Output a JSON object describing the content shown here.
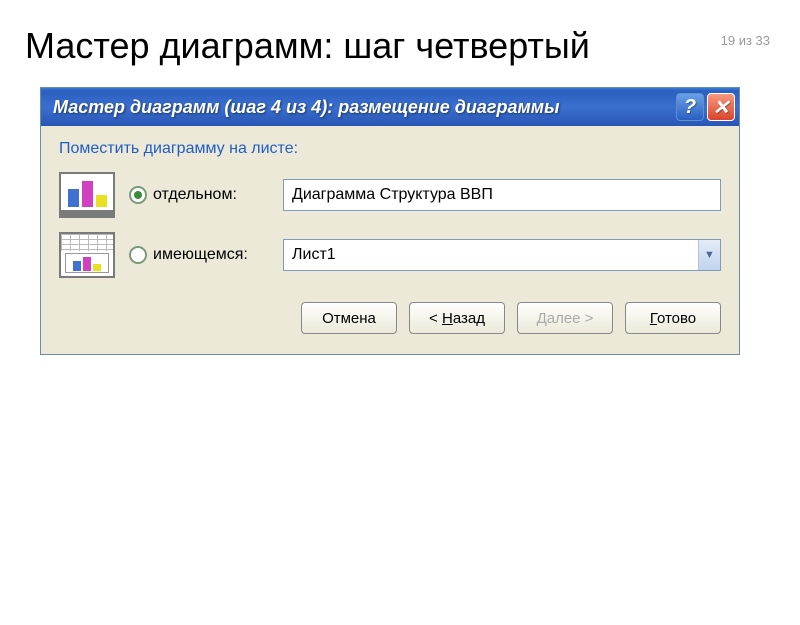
{
  "page_counter": "19 из 33",
  "page_title": "Мастер диаграмм: шаг четвертый",
  "dialog": {
    "title": "Мастер диаграмм (шаг 4 из 4): размещение диаграммы",
    "section_label": "Поместить диаграмму на листе:",
    "option_separate": {
      "label": "отдельном:",
      "value": "Диаграмма Структура ВВП",
      "checked": true
    },
    "option_existing": {
      "label": "имеющемся:",
      "value": "Лист1",
      "checked": false
    },
    "buttons": {
      "cancel": "Отмена",
      "back_prefix": "< ",
      "back_letter": "Н",
      "back_rest": "азад",
      "next_prefix": "Далее ",
      "next_suffix": ">",
      "finish_letter": "Г",
      "finish_rest": "отово"
    }
  }
}
